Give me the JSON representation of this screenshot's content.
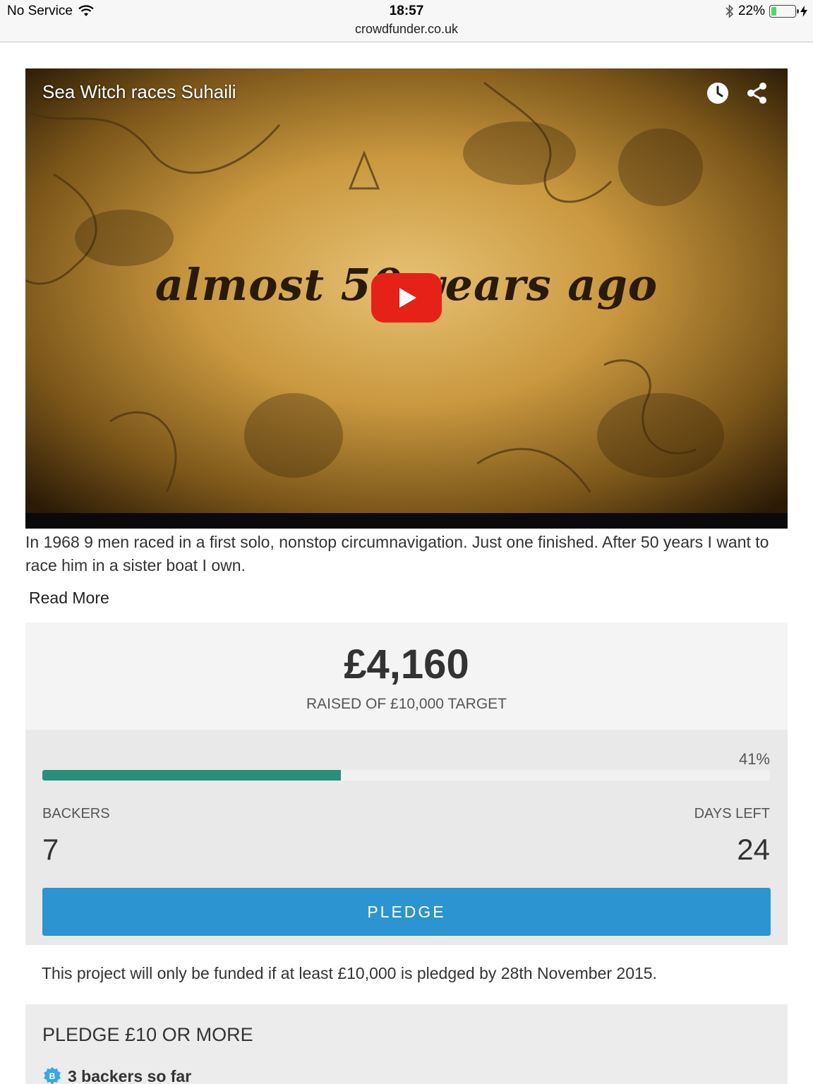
{
  "status_bar": {
    "carrier": "No Service",
    "time": "18:57",
    "url": "crowdfunder.co.uk",
    "battery_percent": "22%",
    "battery_level": 0.22,
    "icons": [
      "wifi-icon",
      "bluetooth-icon",
      "battery-icon",
      "charging-icon"
    ]
  },
  "video": {
    "title": "Sea Witch races Suhaili",
    "overlay_text": "almost 50 years ago",
    "icons": [
      "watch-later-icon",
      "share-icon",
      "play-icon"
    ]
  },
  "description": {
    "text": "In 1968 9 men raced in a first solo, nonstop circumnavigation. Just one finished. After 50 years I want to race him in a sister boat I own.",
    "read_more": "Read More"
  },
  "funding": {
    "amount": "£4,160",
    "raised_label": "RAISED OF £10,000 TARGET",
    "percent_label": "41%",
    "progress": 0.41,
    "backers_label": "BACKERS",
    "backers_value": "7",
    "days_left_label": "DAYS LEFT",
    "days_left_value": "24",
    "pledge_button": "PLEDGE",
    "accent_color": "#2a8f7a",
    "button_color": "#2b94d1"
  },
  "funding_note": "This project will only be funded if at least £10,000 is pledged by 28th November 2015.",
  "reward": {
    "title": "PLEDGE £10 OR MORE",
    "backers_text": "3 backers so far",
    "icon": "backer-badge-icon"
  }
}
